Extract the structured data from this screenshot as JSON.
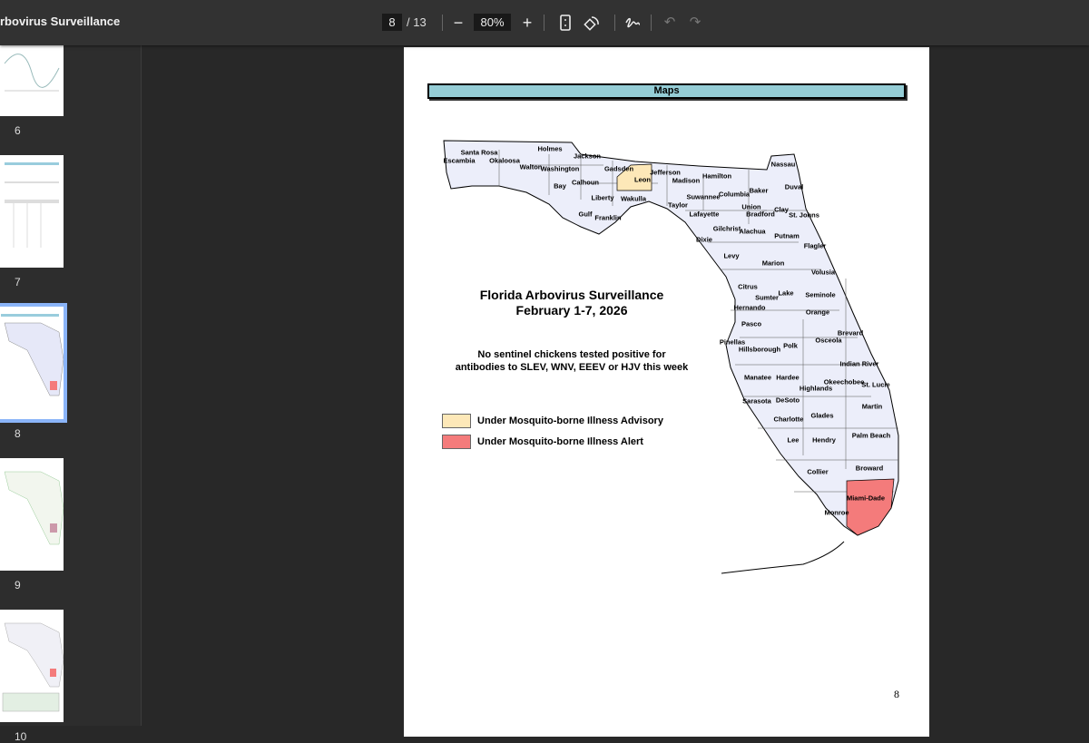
{
  "window": {
    "title": "rbovirus Surveillance"
  },
  "toolbar": {
    "page_current": "8",
    "page_total": "/ 13",
    "zoom": "80%",
    "zoom_out": "−",
    "zoom_in": "+",
    "fit_icon": "fit-page-icon",
    "rotate_icon": "rotate-icon",
    "draw_icon": "annotate-icon",
    "undo_icon": "undo-icon",
    "redo_icon": "redo-icon"
  },
  "sidebar": {
    "thumbnails": [
      {
        "label": "6"
      },
      {
        "label": "7"
      },
      {
        "label": "8",
        "selected": true
      },
      {
        "label": "9"
      },
      {
        "label": "10"
      }
    ]
  },
  "document": {
    "header": "Maps",
    "title_line1": "Florida Arbovirus Surveillance",
    "title_line2": "February 1-7, 2026",
    "summary_line1": "No sentinel chickens tested positive for",
    "summary_line2": "antibodies to SLEV, WNV, EEEV or HJV this week",
    "legend": [
      {
        "label": "Under Mosquito-borne Illness Advisory",
        "color": "#fde8b8"
      },
      {
        "label": "Under Mosquito-borne Illness Alert",
        "color": "#f47b7b"
      }
    ],
    "page_number": "8",
    "counties": [
      "Escambia",
      "Santa Rosa",
      "Okaloosa",
      "Holmes",
      "Jackson",
      "Walton",
      "Washington",
      "Gadsden",
      "Jefferson",
      "Hamilton",
      "Nassau",
      "Bay",
      "Calhoun",
      "Leon",
      "Madison",
      "Baker",
      "Duval",
      "Liberty",
      "Wakulla",
      "Suwannee",
      "Columbia",
      "Taylor",
      "Union",
      "Bradford",
      "Clay",
      "St. Johns",
      "Gulf",
      "Franklin",
      "Lafayette",
      "Gilchrist",
      "Alachua",
      "Putnam",
      "Flagler",
      "Dixie",
      "Levy",
      "Marion",
      "Volusia",
      "Citrus",
      "Sumter",
      "Lake",
      "Seminole",
      "Hernando",
      "Orange",
      "Pasco",
      "Brevard",
      "Pinellas",
      "Hillsborough",
      "Polk",
      "Osceola",
      "Indian River",
      "Manatee",
      "Hardee",
      "Okeechobee",
      "St. Lucie",
      "Highlands",
      "Sarasota",
      "DeSoto",
      "Martin",
      "Charlotte",
      "Glades",
      "Palm Beach",
      "Lee",
      "Hendry",
      "Broward",
      "Collier",
      "Miami-Dade",
      "Monroe"
    ],
    "map_fill": "#eceefa"
  }
}
